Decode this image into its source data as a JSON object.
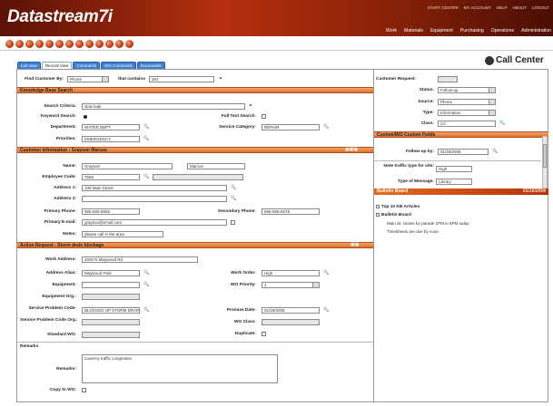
{
  "app": {
    "title": "Datastream7i"
  },
  "top_links": [
    "START CENTER",
    "MY ACCOUNT",
    "HELP",
    "ABOUT",
    "LOGOUT"
  ],
  "nav": [
    "Work",
    "Materials",
    "Equipment",
    "Purchasing",
    "Operations",
    "Administration"
  ],
  "tabs": [
    "List View",
    "Record View",
    "Comments",
    "WO Comments",
    "Documents"
  ],
  "page_title": "Call Center",
  "find": {
    "label": "Find Customer By:",
    "value": "Phone",
    "contains_label": "that contains",
    "contains_value": "381"
  },
  "kb": {
    "title": "Knowledge Base Search",
    "search_criteria_label": "Search Criteria:",
    "search_criteria_value": "slow leak",
    "keyword_label": "Keyword Search:",
    "fulltext_label": "Full Text Search:",
    "department_label": "Department:",
    "department_value": "WATER DEPT",
    "service_category_label": "Service Category:",
    "service_category_value": "REPAIR",
    "priorities_label": "Priorities:",
    "priorities_value": "EMERGENCY"
  },
  "customer": {
    "title": "Customer Information",
    "name_header": "Grayson Marcus",
    "name_label": "Name:",
    "first": "Grayson",
    "last": "Marcus",
    "emp_label": "Employee Code:",
    "emp_value": "7568",
    "addr1_label": "Address 1:",
    "addr1_value": "105 Main Street",
    "addr2_label": "Address 2:",
    "addr2_value": "",
    "phone_label": "Primary Phone:",
    "phone_value": "555-555-5555",
    "sphone_label": "Secondary Phone:",
    "sphone_value": "555-555-5578",
    "email_label": "Primary E-mail:",
    "email_value": "grayson@email.com",
    "notes_label": "Notes:",
    "notes_value": "please call in the area"
  },
  "action": {
    "title": "Action Request",
    "subtitle": "Storm drain blockage",
    "work_addr_label": "Work Address:",
    "work_addr_value": "1000 N Maywood Rd",
    "alias_label": "Address Alias:",
    "alias_value": "Maywood Park",
    "wo_label": "Work Order:",
    "wo_value": "High",
    "equip_label": "Equipment:",
    "equip_value": "",
    "wopri_label": "WO Priority:",
    "wopri_value": "1",
    "equip_org_label": "Equipment Org.:",
    "problem_label": "Service Problem Code:",
    "problem_value": "BLOCKED UP STORM DRAIN",
    "promise_label": "Promise Date:",
    "promise_value": "01/19/2008",
    "problem_org_label": "Service Problem Code Org.:",
    "woclass_label": "WO Class:",
    "std_wo_label": "Standard WO:",
    "dup_label": "Duplicate:"
  },
  "remarks": {
    "title": "Remarks",
    "label": "Remarks:",
    "value": "Caverny traffic congestion",
    "copy_label": "Copy to WO:"
  },
  "right": {
    "customer_request_label": "Customer Request:",
    "status_label": "Status:",
    "status_value": "Follow-up",
    "source_label": "Source:",
    "source_value": "Phone",
    "type_label": "Type:",
    "type_value": "Information",
    "class_label": "Class:",
    "class_value": "CC",
    "custom_title": "Custom/WO Custom Fields",
    "followup_label": "Follow-up by:",
    "followup_value": "01/20/2008",
    "traffic_label": "Note traffic type for site:",
    "traffic_value": "High",
    "message_label": "Type of Message:",
    "message_value": "Library"
  },
  "bulletin": {
    "title": "Bulletin Board",
    "date": "01/16/2008",
    "items": [
      "Top 10 KB Articles",
      "Bulletin Board"
    ],
    "notes": [
      "Main St. closes for parade 1PM to 6PM today",
      "Timesheets are due by noon"
    ]
  },
  "colors": {
    "brand": "#b5300e",
    "section": "#e06f2a",
    "tab": "#3d7fd1"
  }
}
